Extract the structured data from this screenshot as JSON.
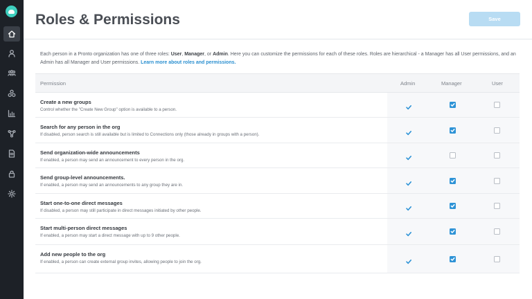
{
  "header": {
    "title": "Roles & Permissions",
    "save_label": "Save"
  },
  "sidebar": {
    "items": [
      {
        "icon": "home-icon",
        "active": true
      },
      {
        "icon": "user-icon",
        "active": false
      },
      {
        "icon": "users-icon",
        "active": false
      },
      {
        "icon": "groups-icon",
        "active": false
      },
      {
        "icon": "analytics-icon",
        "active": false
      },
      {
        "icon": "integrations-icon",
        "active": false
      },
      {
        "icon": "document-icon",
        "active": false
      },
      {
        "icon": "lock-icon",
        "active": false
      },
      {
        "icon": "gear-icon",
        "active": false
      }
    ]
  },
  "description": {
    "text_1": "Each person in a Pronto organization has one of three roles: ",
    "role_user": "User",
    "sep_1": ", ",
    "role_manager": "Manager",
    "sep_2": ", or ",
    "role_admin": "Admin",
    "text_2": ". Here you can customize the permissions for each of these roles. Roles are hierarchical - a Manager has all User permissions, and an Admin has all Manager and User permissions. ",
    "link": "Learn more about roles and permissions."
  },
  "table": {
    "columns": {
      "permission": "Permission",
      "admin": "Admin",
      "manager": "Manager",
      "user": "User"
    },
    "rows": [
      {
        "name": "Create a new groups",
        "desc": "Control whether the \"Create New Group\" option is available to a person.",
        "admin": true,
        "manager": true,
        "user": false
      },
      {
        "name": "Search for any person in the org",
        "desc": "If disabled, person search is still available but is limited to Connections only (those already in groups with a person).",
        "admin": true,
        "manager": true,
        "user": false
      },
      {
        "name": "Send organization-wide announcements",
        "desc": "If enabled, a person may send an announcement to every person in the org.",
        "admin": true,
        "manager": false,
        "user": false
      },
      {
        "name": "Send group-level announcements.",
        "desc": "If enabled, a person may send an announcements to any group they are in.",
        "admin": true,
        "manager": true,
        "user": false
      },
      {
        "name": "Start one-to-one direct messages",
        "desc": "If disabled, a person may still participate in direct messages initiated by other people.",
        "admin": true,
        "manager": true,
        "user": false
      },
      {
        "name": "Start multi-person direct messages",
        "desc": "If enabled, a person may start a direct message with up to 9 other people.",
        "admin": true,
        "manager": true,
        "user": false
      },
      {
        "name": "Add new people to the org",
        "desc": "If enabled, a person can create external group invites, allowing people to join the org.",
        "admin": true,
        "manager": true,
        "user": false
      }
    ]
  }
}
